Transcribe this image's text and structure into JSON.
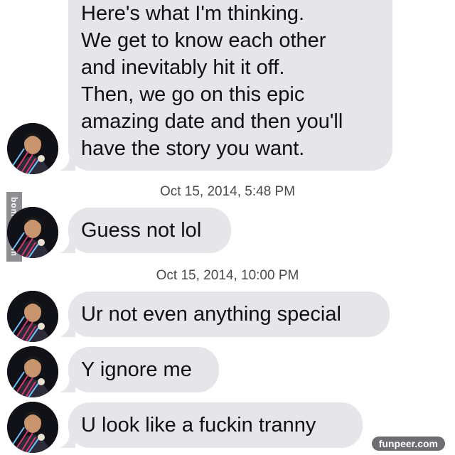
{
  "conversation": {
    "messages": [
      {
        "lines": [
          "Here's what I'm thinking.",
          "We get to know each other",
          "and inevitably hit it off.",
          "Then, we go on this epic",
          "amazing date and then you'll",
          "have the story you want."
        ]
      },
      {
        "lines": [
          "Guess not lol"
        ]
      },
      {
        "lines": [
          "Ur not even anything special"
        ]
      },
      {
        "lines": [
          "Y ignore me"
        ]
      },
      {
        "lines": [
          "U look like a fuckin tranny"
        ]
      }
    ],
    "timestamps": [
      "Oct 15, 2014, 5:48 PM",
      "Oct 15, 2014, 10:00 PM"
    ],
    "bubble_color": "#e5e5ea",
    "text_color": "#111111",
    "avatar_icon": "user-photo-icon"
  },
  "watermarks": {
    "side": "bomb01.com",
    "corner": "funpeer.com"
  }
}
